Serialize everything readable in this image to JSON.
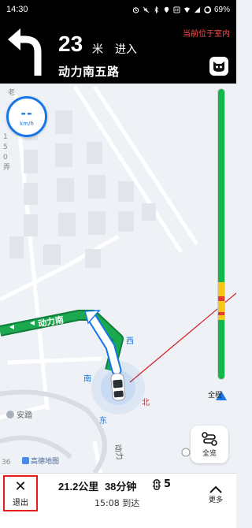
{
  "status_bar": {
    "time": "14:30",
    "battery": "69%"
  },
  "guidance": {
    "distance": "23",
    "unit": "米",
    "action": "进入",
    "road": "动力南五路",
    "indoor_notice": "当前位于室内",
    "turn_icon": "turn-left-arrow-icon"
  },
  "speed": {
    "value": "--",
    "unit": "km/h"
  },
  "map": {
    "compass": {
      "west": "西",
      "south": "南",
      "north": "北",
      "east": "东"
    },
    "route_label": "动力南",
    "road_label": "动力",
    "poi": "安踏",
    "watermark": "高德地图",
    "edge_text_left": "老",
    "edge_text_side": "1 5 0 弄",
    "edge_text_bottom": "36"
  },
  "traffic_bar": {
    "label": "全程",
    "colors": {
      "free": "#14b84a",
      "slow": "#f5c518",
      "jam": "#e43a2f"
    }
  },
  "overview": {
    "label": "全览"
  },
  "bottom_bar": {
    "exit_label": "退出",
    "distance": "21.2公里",
    "duration": "38分钟",
    "lights": "5",
    "arrival": "15:08 到达",
    "more_label": "更多"
  },
  "colors": {
    "accent": "#1677e6",
    "route_green": "#1ba84f",
    "alert_red": "#e31b1b"
  }
}
